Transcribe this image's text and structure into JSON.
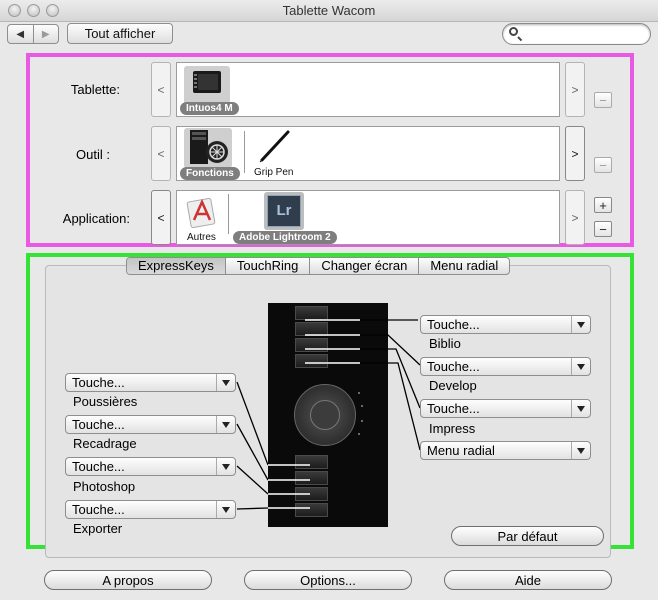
{
  "window": {
    "title": "Tablette Wacom"
  },
  "toolbar": {
    "back_glyph": "◀",
    "forward_glyph": "▶",
    "show_all_label": "Tout afficher",
    "search_value": ""
  },
  "rows": {
    "tablet": {
      "label": "Tablette:",
      "prev": "<",
      "next": ">",
      "items": [
        {
          "name": "Intuos4 M",
          "selected": true
        }
      ]
    },
    "tool": {
      "label": "Outil :",
      "prev": "<",
      "next": ">",
      "items": [
        {
          "name": "Fonctions",
          "selected": true
        },
        {
          "name": "Grip Pen",
          "selected": false
        }
      ]
    },
    "application": {
      "label": "Application:",
      "prev": "<",
      "next": ">",
      "items": [
        {
          "name": "Autres",
          "selected": false
        },
        {
          "name": "Adobe Lightroom 2",
          "selected": true
        }
      ],
      "lightroom_icon_text": "Lr"
    }
  },
  "buttons": {
    "plus": "+",
    "minus": "−"
  },
  "tabs": [
    "ExpressKeys",
    "TouchRing",
    "Changer écran",
    "Menu radial"
  ],
  "active_tab": "ExpressKeys",
  "right_keys": [
    {
      "value": "Touche...",
      "label": "Biblio"
    },
    {
      "value": "Touche...",
      "label": "Develop"
    },
    {
      "value": "Touche...",
      "label": "Impress"
    },
    {
      "value": "Menu radial",
      "label": ""
    }
  ],
  "left_keys": [
    {
      "value": "Touche...",
      "label": "Poussières"
    },
    {
      "value": "Touche...",
      "label": "Recadrage"
    },
    {
      "value": "Touche...",
      "label": "Photoshop"
    },
    {
      "value": "Touche...",
      "label": "Exporter"
    }
  ],
  "default_button": "Par défaut",
  "footer": {
    "about": "A propos",
    "options": "Options...",
    "help": "Aide"
  },
  "colors": {
    "highlight_top": "#e85ae3",
    "highlight_bottom": "#36e236"
  }
}
